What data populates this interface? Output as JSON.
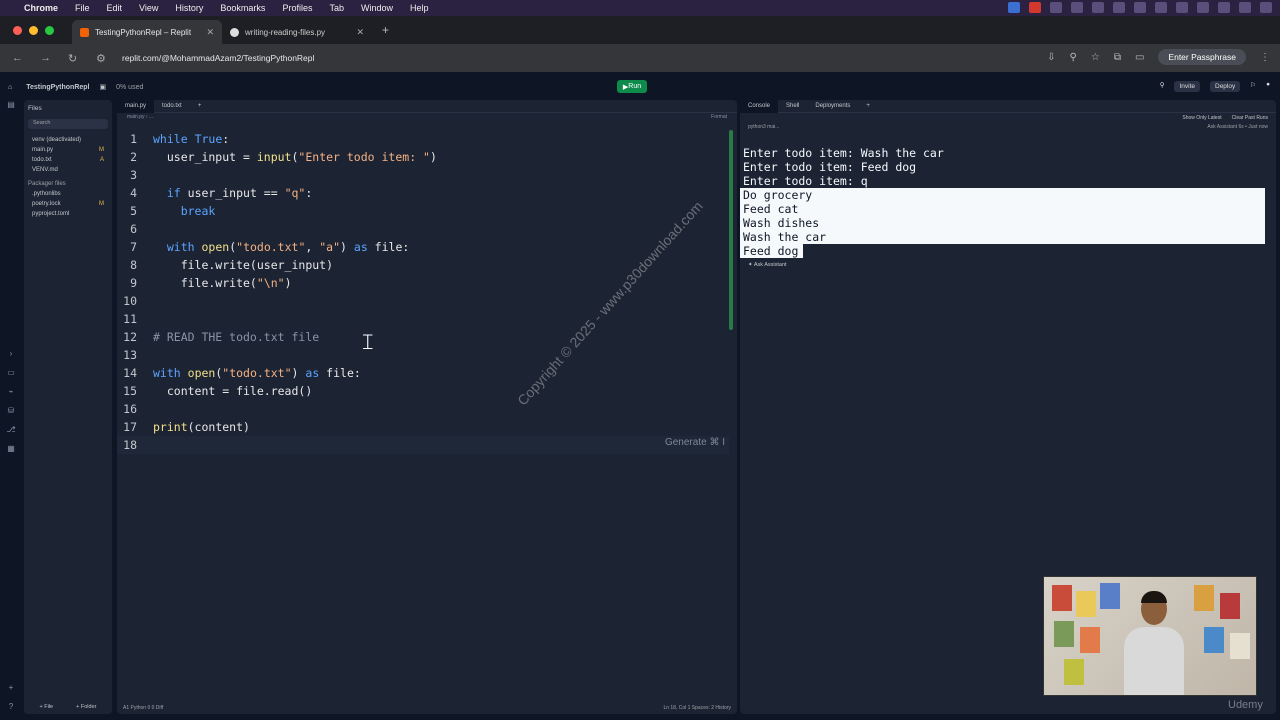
{
  "mac": {
    "app": "Chrome",
    "menus": [
      "File",
      "Edit",
      "View",
      "History",
      "Bookmarks",
      "Profiles",
      "Tab",
      "Window",
      "Help"
    ]
  },
  "browser": {
    "tabs": [
      {
        "title": "TestingPythonRepl – Replit"
      },
      {
        "title": "writing-reading-files.py"
      }
    ],
    "url": "replit.com/@MohammadAzam2/TestingPythonRepl",
    "passphrase": "Enter Passphrase"
  },
  "app": {
    "repl_name": "TestingPythonRepl",
    "usage": "0% used",
    "run": "Run",
    "invite": "Invite",
    "deploy": "Deploy"
  },
  "files": {
    "title": "Files",
    "search": "Search",
    "items": [
      {
        "name": "venv (deactivated)",
        "mark": ""
      },
      {
        "name": "main.py",
        "mark": "M"
      },
      {
        "name": "todo.txt",
        "mark": "A"
      },
      {
        "name": "VENV.md",
        "mark": ""
      }
    ],
    "packager_title": "Packager files",
    "packager": [
      {
        "name": ".pythonlibs",
        "mark": ""
      },
      {
        "name": "poetry.lock",
        "mark": "M"
      },
      {
        "name": "pyproject.toml",
        "mark": ""
      }
    ],
    "new_file": "+ File",
    "new_folder": "+ Folder"
  },
  "editor": {
    "tabs": [
      "main.py",
      "todo.txt"
    ],
    "breadcrumb": "main.py › ...",
    "format": "Format",
    "generate": "Generate ⌘ I",
    "status_left": "A1  Python  0  0  Diff",
    "status_right": "Ln 18, Col 1   Spaces: 2   History"
  },
  "console": {
    "tabs": [
      "Console",
      "Shell",
      "Deployments"
    ],
    "show_latest": "Show Only Latest",
    "clear": "Clear Past Runs",
    "proc": "python3 mai...",
    "ask": "Ask Assistant",
    "time": "6s • Just now",
    "lines": [
      "Enter todo item: Wash the car",
      "Enter todo item: Feed dog",
      "Enter todo item: q"
    ],
    "selected": [
      "Do grocery",
      "Feed cat",
      "Wash dishes",
      "Wash the car",
      "Feed dog"
    ]
  },
  "watermark": "Copyright © 2025 - www.p30download.com",
  "brand": "Udemy"
}
